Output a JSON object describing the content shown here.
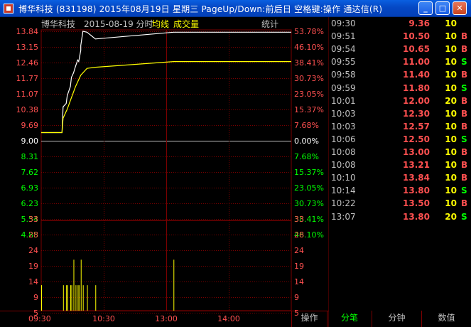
{
  "window": {
    "title": "博华科技 (831198) 2015年08月19日 星期三 PageUp/Down:前后日 空格键:操作 通达信(R)",
    "controls": [
      "minimize",
      "maximize",
      "close"
    ]
  },
  "header": {
    "name": "博华科技",
    "date_label": "2015-08-19 分时",
    "avg_label": "均线",
    "vol_label": "成交量",
    "stat_label": "统计"
  },
  "colors": {
    "up": "#ff5050",
    "down": "#00ff00",
    "flat": "#c0c0c0",
    "grid": "#7a0000",
    "price_line": "#ffffff",
    "avg_line": "#ffff00",
    "volume": "#ffff00"
  },
  "chart_data": [
    {
      "type": "line",
      "title": "",
      "prev_close": 9.0,
      "price_ticks": [
        "13.84",
        "13.15",
        "12.46",
        "11.77",
        "11.07",
        "10.38",
        "9.69",
        "9.00",
        "8.31",
        "7.62",
        "6.93",
        "6.23",
        "5.54",
        "4.85"
      ],
      "pct_ticks": [
        "53.78%",
        "46.10%",
        "38.41%",
        "30.73%",
        "23.05%",
        "15.37%",
        "7.68%",
        "0.00%",
        "7.68%",
        "15.37%",
        "23.05%",
        "30.73%",
        "38.41%",
        "46.10%"
      ],
      "x_labels": [
        "09:30",
        "10:30",
        "13:00",
        "14:00"
      ],
      "ylim": [
        4.85,
        13.84
      ],
      "series": [
        {
          "x": [
            "09:30",
            "09:50",
            "09:51",
            "09:54",
            "09:55",
            "09:58",
            "09:59",
            "10:01",
            "10:03",
            "10:05",
            "10:06",
            "10:08",
            "10:08b",
            "10:10",
            "10:14",
            "10:22",
            "13:07",
            "15:00"
          ],
          "values": [
            9.36,
            9.36,
            10.5,
            10.65,
            11.0,
            11.4,
            11.8,
            12.0,
            12.3,
            12.57,
            12.5,
            13.0,
            13.21,
            13.84,
            13.8,
            13.5,
            13.8,
            13.8
          ]
        },
        {
          "x": [
            "09:30",
            "09:50",
            "09:51",
            "09:55",
            "09:59",
            "10:03",
            "10:08",
            "10:14",
            "10:22",
            "13:07",
            "15:00"
          ],
          "values": [
            9.36,
            9.36,
            10.0,
            10.4,
            10.9,
            11.4,
            11.9,
            12.2,
            12.25,
            12.5,
            12.5
          ]
        }
      ]
    },
    {
      "type": "bar",
      "title": "",
      "y_ticks": [
        "33",
        "28",
        "24",
        "19",
        "14",
        "9",
        "5"
      ],
      "ylim": [
        0,
        36
      ],
      "bars": [
        {
          "x": "09:30",
          "value": 10
        },
        {
          "x": "09:51",
          "value": 10
        },
        {
          "x": "09:54",
          "value": 10
        },
        {
          "x": "09:55",
          "value": 10
        },
        {
          "x": "09:58",
          "value": 10
        },
        {
          "x": "09:59",
          "value": 10
        },
        {
          "x": "10:01",
          "value": 20
        },
        {
          "x": "10:03",
          "value": 10
        },
        {
          "x": "10:05",
          "value": 10
        },
        {
          "x": "10:06",
          "value": 10
        },
        {
          "x": "10:08",
          "value": 20
        },
        {
          "x": "10:10",
          "value": 10
        },
        {
          "x": "10:14",
          "value": 10
        },
        {
          "x": "10:22",
          "value": 10
        },
        {
          "x": "13:07",
          "value": 20
        }
      ]
    }
  ],
  "ticks": [
    {
      "time": "09:30",
      "price": "9.36",
      "vol": "10",
      "dir": ""
    },
    {
      "time": "09:51",
      "price": "10.50",
      "vol": "10",
      "dir": "B"
    },
    {
      "time": "09:54",
      "price": "10.65",
      "vol": "10",
      "dir": "B"
    },
    {
      "time": "09:55",
      "price": "11.00",
      "vol": "10",
      "dir": "S"
    },
    {
      "time": "09:58",
      "price": "11.40",
      "vol": "10",
      "dir": "B"
    },
    {
      "time": "09:59",
      "price": "11.80",
      "vol": "10",
      "dir": "S"
    },
    {
      "time": "10:01",
      "price": "12.00",
      "vol": "20",
      "dir": "B"
    },
    {
      "time": "10:03",
      "price": "12.30",
      "vol": "10",
      "dir": "B"
    },
    {
      "time": "10:03",
      "price": "12.57",
      "vol": "10",
      "dir": "B"
    },
    {
      "time": "10:06",
      "price": "12.50",
      "vol": "10",
      "dir": "S"
    },
    {
      "time": "10:08",
      "price": "13.00",
      "vol": "10",
      "dir": "B"
    },
    {
      "time": "10:08",
      "price": "13.21",
      "vol": "10",
      "dir": "B"
    },
    {
      "time": "10:10",
      "price": "13.84",
      "vol": "10",
      "dir": "B"
    },
    {
      "time": "10:14",
      "price": "13.80",
      "vol": "10",
      "dir": "S"
    },
    {
      "time": "10:22",
      "price": "13.50",
      "vol": "10",
      "dir": "B"
    },
    {
      "time": "13:07",
      "price": "13.80",
      "vol": "20",
      "dir": "S"
    }
  ],
  "tabs": {
    "operate": "操作",
    "ticks": "分笔",
    "minute": "分钟",
    "value": "数值"
  }
}
